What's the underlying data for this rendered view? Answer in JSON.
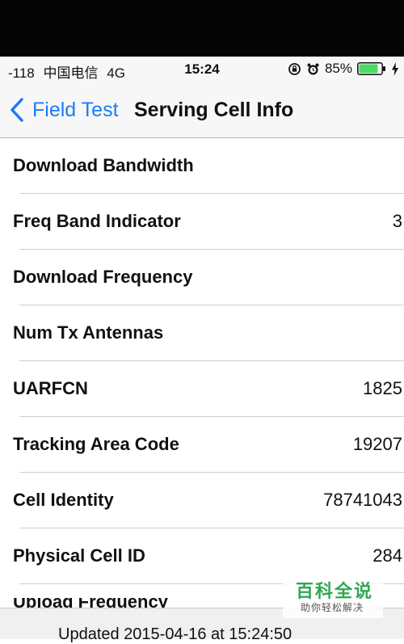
{
  "status_bar": {
    "signal": "-118",
    "carrier": "中国电信",
    "network": "4G",
    "time": "15:24",
    "battery_percent": "85%",
    "battery_level": 0.85,
    "battery_color": "#4cd964"
  },
  "nav": {
    "back_label": "Field Test",
    "title": "Serving Cell Info",
    "accent_color": "#1b7cf6"
  },
  "rows": [
    {
      "label": "Download Bandwidth",
      "value": ""
    },
    {
      "label": "Freq Band Indicator",
      "value": "3"
    },
    {
      "label": "Download Frequency",
      "value": ""
    },
    {
      "label": "Num Tx Antennas",
      "value": ""
    },
    {
      "label": "UARFCN",
      "value": "1825"
    },
    {
      "label": "Tracking Area Code",
      "value": "19207"
    },
    {
      "label": "Cell Identity",
      "value": "78741043"
    },
    {
      "label": "Physical Cell ID",
      "value": "284"
    }
  ],
  "partial_row": {
    "label": "Upload Frequency"
  },
  "footer": {
    "text": "Updated 2015-04-16 at 15:24:50"
  },
  "watermark": {
    "title": "百科全说",
    "subtitle": "助你轻松解决"
  }
}
